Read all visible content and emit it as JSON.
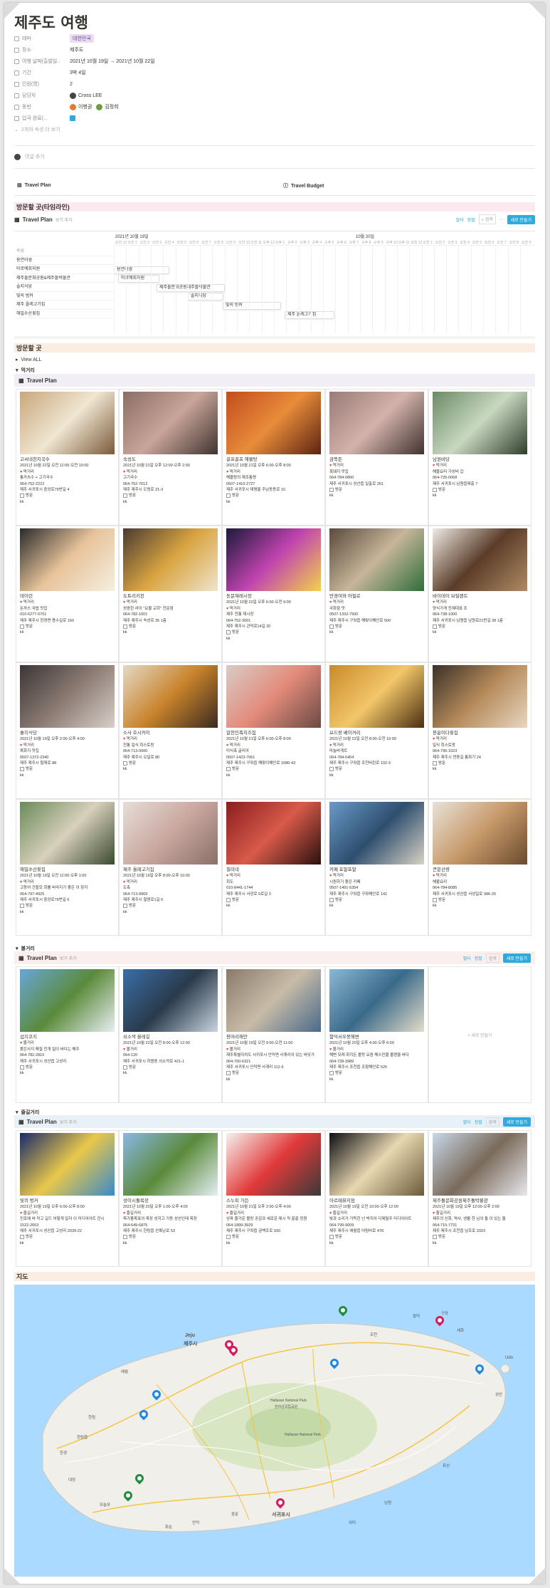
{
  "title": "제주도 여행",
  "props": {
    "theme_k": "테마",
    "theme_v": "대한민국",
    "place_k": "장소",
    "place_v": "제주도",
    "date_k": "여행 날짜(출발일..",
    "date_v": "2021년 10월 19일 → 2021년 10월 22일",
    "period_k": "기간",
    "period_v": "3박 4일",
    "count_k": "인원(명)",
    "count_v": "2",
    "owner_k": "담당자",
    "owner_v": "Cross LEE",
    "partner_k": "동반",
    "partner_v1": "이병권",
    "partner_v2": "김정희",
    "insurance_k": "입국 완료(...",
    "more": "2개의 속성 더 보기",
    "comment": "댓글 추가"
  },
  "links": {
    "plan": "Travel Plan",
    "budget": "Travel Budget"
  },
  "sections": {
    "timeline": "방문할 곳(타임라인)",
    "visit": "방문할 곳",
    "map": "지도"
  },
  "db": {
    "name": "Travel Plan",
    "view": "보기 추가",
    "view_all": "View ALL",
    "filter": "필터",
    "sort": "정렬",
    "search": "검색",
    "new": "새로 만들기"
  },
  "timeline": {
    "month1": "2021년 10월 19일",
    "month2": "10월 20일",
    "prop_label": "속성",
    "hours": [
      "오전 12",
      "오전 1",
      "오전 2",
      "오전 3",
      "오전 4",
      "오전 5",
      "오전 6",
      "오전 7",
      "오전 8",
      "오전 9",
      "오전 10",
      "오전 11",
      "오후 12",
      "오후 1",
      "오후 2",
      "오후 3",
      "오후 4",
      "오후 5",
      "오후 6",
      "오후 7",
      "오후 8",
      "오후 9",
      "오후 10",
      "오후 11",
      "오전 12",
      "오전 1",
      "오전 2",
      "오전 3",
      "오전 4",
      "오전 5",
      "오전 6",
      "오전 7",
      "오전 8",
      "오전 9"
    ],
    "names": [
      "용연야경",
      "미로에회지원",
      "제주돌문화공원&제주돌박물관",
      "솔지식당",
      "빛의 벙커",
      "제주 올레고기집",
      "해밀수산횟집"
    ],
    "bars": [
      "용연야경",
      "미로에회지원",
      "제주돌문화공원제주돌박물관",
      "솔지식당",
      "빛의 벙커",
      "제주 올레고기집"
    ]
  },
  "groups": {
    "eat": "먹거리",
    "see": "볼거리",
    "play": "즐길거리"
  },
  "eat_cards": [
    {
      "name": "고씨네천지국수",
      "l1": "2021년 10월 22일 오전 11:00-오전 10:00",
      "cat": "먹거리",
      "l2": "통카츠수 + 고기국수",
      "l3": "064-752-2222",
      "l4": "제주 서귀포시 중앙로79번길 4",
      "chk": "방문",
      "foot": "kk"
    },
    {
      "name": "숙성도",
      "l1": "2021년 10월 21일 오후 12:00-오후 2:00",
      "cat": "먹거리",
      "l2": "고기국수",
      "l3": "064-752-7012",
      "l4": "제주 제주시 도령로 21-3",
      "chk": "방문",
      "foot": "kk"
    },
    {
      "name": "골프골프 해물탕",
      "l1": "2021년 10월 21일 오후 6:00-오후 8:00",
      "cat": "먹거리",
      "l2": "해물탕의 제조통령",
      "l3": "0507-1410-2727",
      "l4": "제주 서귀포시 태평을 주남동동로 10",
      "chk": "방문",
      "foot": "kk"
    },
    {
      "name": "금뚝돈",
      "l1": "",
      "cat": "먹거리",
      "l2": "흑돼지 맛집",
      "l3": "064-784-0800",
      "l4": "제주 서귀포시 성산읍 일출로 261",
      "chk": "방문",
      "foot": "kk"
    },
    {
      "name": "남원바당",
      "l1": "",
      "cat": "먹거리",
      "l2": "해물요리 가성비 갑",
      "l3": "064-725-0068",
      "l4": "제주 서귀포시 남원읍태흥 7",
      "chk": "방문",
      "foot": "kk"
    },
    {
      "name": "데이런",
      "l1": "",
      "cat": "먹거리",
      "l2": "돈까스 국밥 맛집",
      "l3": "010-6277-0701",
      "l4": "제주 제주시 한경면 용수길로 160",
      "chk": "방문",
      "foot": "kk"
    },
    {
      "name": "도토리키친",
      "l1": "",
      "cat": "먹거리",
      "l2": "성큼한 라이 \"요물 교회\" 전문점",
      "l3": "064-782-1001",
      "l4": "제주 제주시 속성로 35 1층",
      "chk": "방문",
      "foot": "kk"
    },
    {
      "name": "동문재래시장",
      "l1": "2021년 10월 22일 오후 6:00-오전 9:00",
      "cat": "먹거리",
      "l2": "제주 전통 재시장",
      "l3": "064-752-3001",
      "l4": "제주 제주시 관덕로14길 20",
      "chk": "방문",
      "foot": "kk"
    },
    {
      "name": "만경여와 아필로",
      "l1": "",
      "cat": "먹거리",
      "l2": "국화향 맛",
      "l3": "0507-1332-7500",
      "l4": "제주 제주시 구좌읍 해맞이해안로 500",
      "chk": "방문",
      "foot": "kk"
    },
    {
      "name": "바이데이 브릴렌트",
      "l1": "",
      "cat": "먹거리",
      "l2": "양식가게 전제대표 조",
      "l3": "064-738-1000",
      "l4": "제주 서귀포시 남원읍 남원로21번길 28 1층",
      "chk": "방문",
      "foot": "kk"
    },
    {
      "name": "솔지식당",
      "l1": "2021년 10월 19일 오후 2:00-오후 4:00",
      "cat": "먹거리",
      "l2": "목화지 맛집",
      "l3": "0507-1372-2340",
      "l4": "제주 제주시 협재로 88",
      "chk": "방문",
      "foot": "kk"
    },
    {
      "name": "소사 호시카이",
      "l1": "",
      "cat": "먹거리",
      "l2": "전통 일식 회스토랑",
      "l3": "064-713-0000",
      "l4": "제주 제주시 오일로 80",
      "chk": "방문",
      "foot": "kk"
    },
    {
      "name": "알찬민족치즈집",
      "l1": "2021년 10월 21일 오후 6:00-오후 8:00",
      "cat": "먹거리",
      "l2": "미식축 글리아",
      "l3": "0507-1423-7061",
      "l4": "제주 제주시 구좌읍 해맞이해안로 1586-43",
      "chk": "방문",
      "foot": "kk"
    },
    {
      "name": "요드랑 베이커리",
      "l1": "2021년 10월 22일 오전 8:00-오전 10:00",
      "cat": "먹거리",
      "l2": "마늘바게트",
      "l3": "064-784-5404",
      "l4": "제주 제주시 구좌읍 조천비린로 102-3",
      "chk": "방문",
      "foot": "kk"
    },
    {
      "name": "용윤어다횟집",
      "l1": "",
      "cat": "먹거리",
      "l2": "일식 회스토랑",
      "l3": "064-795-1023",
      "l4": "제주 제주시 연동길 통화기 24",
      "chk": "방문",
      "foot": "kk"
    },
    {
      "name": "해밀수산횟집",
      "l1": "2021년 10월 19일 오전 11:00-오후 1:00",
      "cat": "먹거리",
      "l2": "고등어 건할모 회를 바라지기 좋은 이 장지",
      "l3": "064-797-4925",
      "l4": "제주 서귀포시 중앙로79번길 6",
      "chk": "방문",
      "foot": "kk"
    },
    {
      "name": "제주 올레고기집",
      "l1": "2021년 10월 19일 오후 8:00-오후 10:00",
      "cat": "먹거리",
      "l2": "도축",
      "l3": "064-713-9969",
      "l4": "제주 제주시 철원로1길 6",
      "chk": "방문",
      "foot": "kk"
    },
    {
      "name": "칠미네",
      "l1": "",
      "cat": "먹거리",
      "l2": "회도",
      "l3": "010-8441-1744",
      "l4": "제주 제주시 서광로 0로길 3",
      "chk": "방문",
      "foot": "kk"
    },
    {
      "name": "카페 포말포말",
      "l1": "",
      "cat": "먹거리",
      "l2": "시원하기 좋은 카페",
      "l3": "0507-1491-5354",
      "l4": "제주 제주시 구좌읍 구좌해안로 141",
      "chk": "방문",
      "foot": "kk"
    },
    {
      "name": "큰문산량",
      "l1": "",
      "cat": "먹거리",
      "l2": "해물요리",
      "l3": "064-784-8085",
      "l4": "제주 서귀포시 성산읍 서성일로 986-26",
      "chk": "방문",
      "foot": "kk"
    }
  ],
  "see_cards": [
    {
      "name": "섭지코지",
      "l1": "",
      "cat": "볼거리",
      "l2": "붉은사지 해질 전개 일이 바다는 해주",
      "l3": "064-782-2810",
      "l4": "제주 서귀포시 성산읍 고성리",
      "chk": "방문",
      "foot": "kk"
    },
    {
      "name": "쇠소깍 올레길",
      "l1": "2021년 10월 22일 오전 8:00-오후 12:00",
      "cat": "볼거리",
      "l2": "",
      "l3": "064-120",
      "l4": "제주 서귀포시 하원동 쇠소깍로 421-1",
      "chk": "방문",
      "foot": "kk"
    },
    {
      "name": "용머리해안",
      "l1": "2021년 10월 19일 오전 9:00-오전 11:00",
      "cat": "볼거리",
      "l2": "제주특별자치도 서귀포시 안덕면 사계리의 있는 바닷가",
      "l3": "064-760-6321",
      "l4": "제주 서귀포시 안덕면 사계리 112-3",
      "chk": "방문",
      "foot": "kk"
    },
    {
      "name": "함덕서우봉해변",
      "l1": "2021년 10월 20일 오후 4:00-오후 6:00",
      "cat": "볼거리",
      "l2": "해변 모래 화지든 볼랑 요즘 해수진물 볼랜을 바다",
      "l3": "064-728-3989",
      "l4": "제주 제주시 조천읍 조함해안로 525",
      "chk": "방문",
      "foot": "kk"
    }
  ],
  "see_empty": "+ 새로 만들기",
  "play_cards": [
    {
      "name": "빛의 벙커",
      "l1": "2021년 10월 19일 오후 6:00-오후 8:00",
      "cat": "즐길거리",
      "l2": "진로에 바 작고 길드 어떻게 일자 이 미디어아트 전시",
      "l3": "1522-2653",
      "l4": "제주 서귀포시 성산읍 고성리 2039-22",
      "chk": "방문",
      "foot": "kk"
    },
    {
      "name": "성이시돌목장",
      "l1": "2021년 10월 20일 오후 1:00-오후 4:00",
      "cat": "즐길거리",
      "l2": "목가풍목표의 목장 성지고 가동 성산인테 목장",
      "l3": "064-649-6875",
      "l4": "제주 제주시 한림읍 산록남로 53",
      "chk": "방문",
      "foot": "kk"
    },
    {
      "name": "스누피 가든",
      "l1": "2021년 10월 21일 오후 2:00-오후 4:00",
      "cat": "즐길거리",
      "l2": "상파 즐거운 볼랑 공감과 세로운 제시 작 끝끝 정원",
      "l3": "064-1899-3929",
      "l4": "제주 제주시 구좌읍 금백조로 930",
      "chk": "방문",
      "foot": "kk"
    },
    {
      "name": "아르떼뮤지엄",
      "l1": "2021년 10월 19일 오전 10:00-오후 12:00",
      "cat": "즐길거리",
      "l2": "빛과 소리가 가득한 넌 박지아 디제탈주 미디어아트",
      "l3": "064-799-9009",
      "l4": "제주 제주시 애월읍 어림비로 478",
      "chk": "방문",
      "foot": "kk"
    },
    {
      "name": "제주돌문화공원제주돌박물관",
      "l1": "2021년 10월 19일 오후 12:00-오후 2:00",
      "cat": "즐길거리",
      "l2": "제주의 신화, 역사, 생활 한 님의 돌 이 있는 돌",
      "l3": "064-710-7731",
      "l4": "제주 제주시 조천읍 남조로 2023",
      "chk": "방문",
      "foot": "kk"
    }
  ],
  "map": {
    "jeju_kr": "제주시",
    "jeju_en": "Jeju",
    "seogwipo_kr": "서귀포시",
    "hallasan_en": "Hallasan National Park",
    "hallasan_kr": "한라산국립공원",
    "hallasan2": "Hallasan National Park",
    "udo": "Udo",
    "labels": [
      "애월",
      "한림",
      "모슬포",
      "대정",
      "안덕",
      "중문",
      "남원",
      "표선",
      "성산",
      "구좌",
      "조천",
      "한경",
      "위미",
      "화순",
      "한림읍",
      "함덕",
      "세화"
    ]
  },
  "colors": {
    "blue": "#2eaadc",
    "red": "#e03e3e",
    "green": "#1e8e3e",
    "pink": "#d81b60",
    "timeline_bg": "#fbe9ef",
    "visit_bg": "#fbede2",
    "eat_bg": "#f1eef5",
    "see_bg": "#fbeeee",
    "play_bg": "#e8f1f8"
  }
}
